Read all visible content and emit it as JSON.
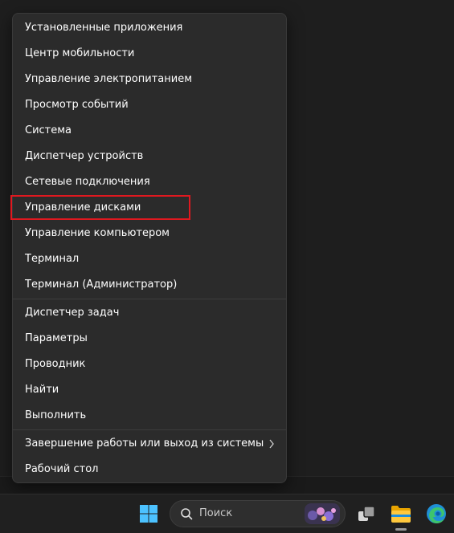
{
  "menu": {
    "items": [
      {
        "label": "Установленные приложения"
      },
      {
        "label": "Центр мобильности"
      },
      {
        "label": "Управление электропитанием"
      },
      {
        "label": "Просмотр событий"
      },
      {
        "label": "Система"
      },
      {
        "label": "Диспетчер устройств"
      },
      {
        "label": "Сетевые подключения"
      },
      {
        "label": "Управление дисками"
      },
      {
        "label": "Управление компьютером"
      },
      {
        "label": "Терминал"
      },
      {
        "label": "Терминал (Администратор)"
      },
      {
        "label": "Диспетчер задач"
      },
      {
        "label": "Параметры"
      },
      {
        "label": "Проводник"
      },
      {
        "label": "Найти"
      },
      {
        "label": "Выполнить"
      },
      {
        "label": "Завершение работы или выход из системы"
      },
      {
        "label": "Рабочий стол"
      }
    ],
    "highlighted_item": "Управление дисками",
    "highlight_color": "#e0181f",
    "submenu_indicator_icon": "chevron-right-icon"
  },
  "taskbar": {
    "search": {
      "placeholder": "Поиск",
      "icon": "search-icon"
    },
    "apps": [
      {
        "icon": "windows-start-icon"
      },
      {
        "icon": "task-view-icon"
      },
      {
        "icon": "file-explorer-icon"
      },
      {
        "icon": "edge-browser-icon"
      }
    ]
  },
  "colors": {
    "menu_background": "#2b2b2b",
    "menu_text": "#ffffff",
    "taskbar_background": "#202020",
    "windows_accent": "#4cc2ff"
  }
}
